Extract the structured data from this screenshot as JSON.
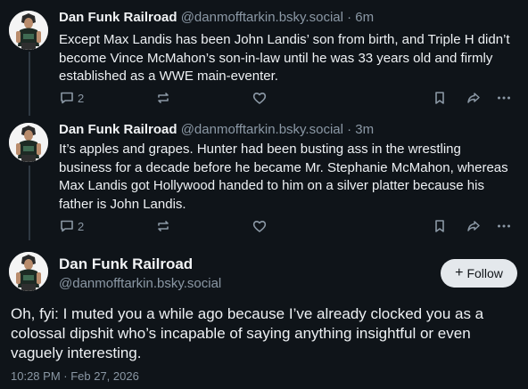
{
  "posts": [
    {
      "author": "Dan Funk Railroad",
      "handle": "@danmofftarkin.bsky.social",
      "separator": "·",
      "time": "6m",
      "text": "Except Max Landis has been John Landis’ son from birth, and Triple H didn’t become Vince McMahon’s son-in-law until he was 33 years old and firmly established as a WWE main-eventer.",
      "reply_count": "2",
      "repost_count": "",
      "like_count": ""
    },
    {
      "author": "Dan Funk Railroad",
      "handle": "@danmofftarkin.bsky.social",
      "separator": "·",
      "time": "3m",
      "text": "It’s apples and grapes. Hunter had been busting ass in the wrestling business for a decade before he became Mr. Stephanie McMahon, whereas Max Landis got Hollywood handed to him on a silver platter because his father is John Landis.",
      "reply_count": "2",
      "repost_count": "",
      "like_count": ""
    }
  ],
  "focus_post": {
    "author": "Dan Funk Railroad",
    "handle": "@danmofftarkin.bsky.social",
    "follow_label": "Follow",
    "follow_icon": "+",
    "text": "Oh, fyi: I muted you a while ago because I’ve already clocked you as a colossal dipshit who’s incapable of saying anything insightful or even vaguely interesting.",
    "timestamp": "10:28 PM · Feb 27, 2026"
  },
  "icons": {
    "reply": "reply-icon",
    "repost": "repost-icon",
    "like": "heart-icon",
    "bookmark": "bookmark-icon",
    "share": "share-icon",
    "more": "more-options-icon"
  },
  "colors": {
    "background": "#0f1419",
    "muted_text": "#8b98a5",
    "follow_button_bg": "#e4e8ec"
  }
}
